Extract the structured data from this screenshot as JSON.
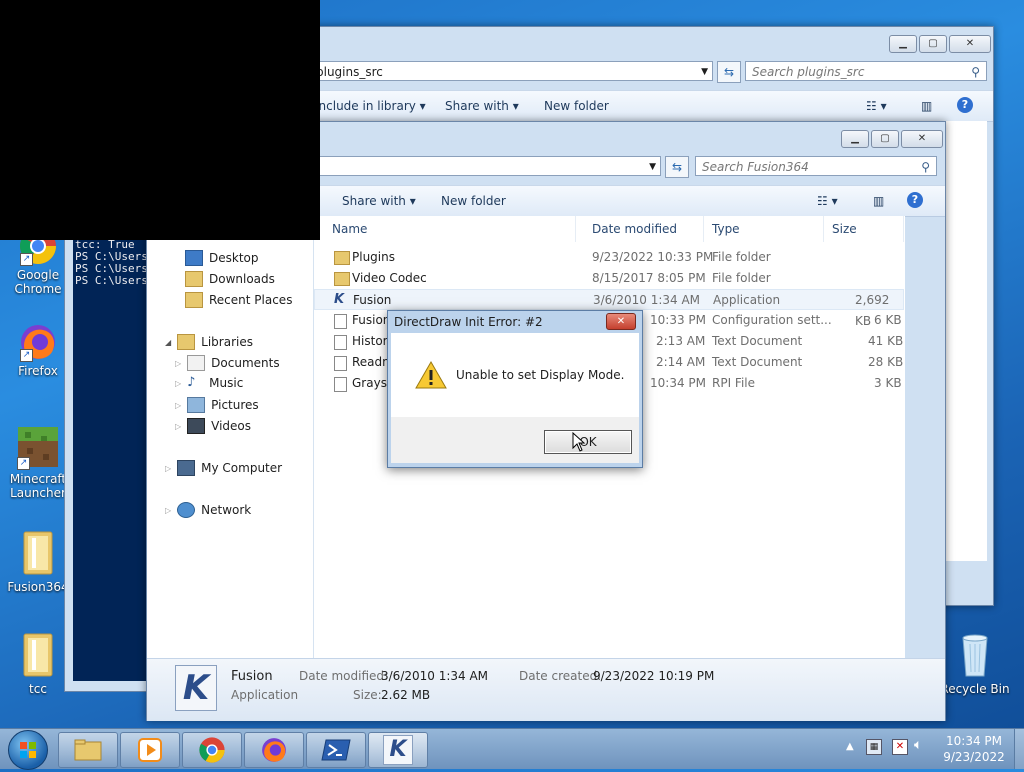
{
  "desktop": {
    "icons": [
      {
        "label": "Google Chrome"
      },
      {
        "label": "Firefox"
      },
      {
        "label": "Minecraft Launcher"
      },
      {
        "label": "Fusion364"
      },
      {
        "label": "tcc"
      },
      {
        "label": "Recycle Bin"
      }
    ]
  },
  "powershell": {
    "lines": [
      "tcc: True",
      "PS C:\\Users",
      "PS C:\\Users",
      "PS C:\\Users"
    ]
  },
  "back_window": {
    "address": "plugins_src",
    "search_placeholder": "Search plugins_src",
    "toolbar": {
      "include": "Include in library",
      "share": "Share with",
      "new_folder": "New folder"
    }
  },
  "explorer": {
    "address": "",
    "search_placeholder": "Search Fusion364",
    "toolbar": {
      "share": "Share with",
      "new_folder": "New folder"
    },
    "nav": {
      "favorites": [
        "Desktop",
        "Downloads",
        "Recent Places"
      ],
      "libraries": "Libraries",
      "library_items": [
        "Documents",
        "Music",
        "Pictures",
        "Videos"
      ],
      "computer": "My Computer",
      "network": "Network"
    },
    "columns": {
      "name": "Name",
      "date": "Date modified",
      "type": "Type",
      "size": "Size"
    },
    "files": [
      {
        "name": "Plugins",
        "date": "9/23/2022 10:33 PM",
        "type": "File folder",
        "size": ""
      },
      {
        "name": "Video Codec",
        "date": "8/15/2017 8:05 PM",
        "type": "File folder",
        "size": ""
      },
      {
        "name": "Fusion",
        "date": "3/6/2010 1:34 AM",
        "type": "Application",
        "size": "2,692 KB"
      },
      {
        "name": "Fusion",
        "date": "10:33 PM",
        "type": "Configuration sett...",
        "size": "6 KB"
      },
      {
        "name": "History",
        "date": "2:13 AM",
        "type": "Text Document",
        "size": "41 KB"
      },
      {
        "name": "Readm",
        "date": "2:14 AM",
        "type": "Text Document",
        "size": "28 KB"
      },
      {
        "name": "Graysc",
        "date": "10:34 PM",
        "type": "RPI File",
        "size": "3 KB"
      }
    ],
    "details": {
      "name": "Fusion",
      "kind": "Application",
      "modified_label": "Date modified:",
      "modified": "3/6/2010 1:34 AM",
      "created_label": "Date created:",
      "created": "9/23/2022 10:19 PM",
      "size_label": "Size:",
      "size": "2.62 MB"
    }
  },
  "dialog": {
    "title": "DirectDraw Init Error: #2",
    "message": "Unable to set Display Mode.",
    "ok": "OK"
  },
  "clock": {
    "time": "10:34 PM",
    "date": "9/23/2022"
  },
  "colors": {
    "dialog_title": "#bcd3ec",
    "accent": "#2a8de0"
  }
}
